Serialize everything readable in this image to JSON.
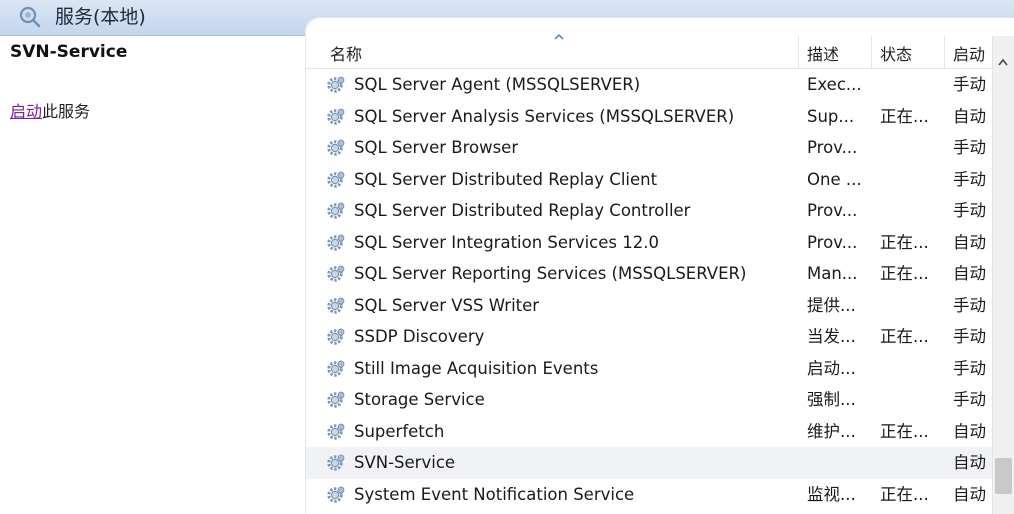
{
  "header": {
    "title": "服务(本地)"
  },
  "left_pane": {
    "service_name": "SVN-Service",
    "action_link": "启动",
    "action_rest": "此服务"
  },
  "columns": {
    "name": "名称",
    "desc": "描述",
    "status": "状态",
    "start": "启动"
  },
  "rows": [
    {
      "name": "SQL Server Agent (MSSQLSERVER)",
      "desc": "Exec...",
      "status": "",
      "start": "手动"
    },
    {
      "name": "SQL Server Analysis Services (MSSQLSERVER)",
      "desc": "Sup...",
      "status": "正在...",
      "start": "自动"
    },
    {
      "name": "SQL Server Browser",
      "desc": "Prov...",
      "status": "",
      "start": "手动"
    },
    {
      "name": "SQL Server Distributed Replay Client",
      "desc": "One ...",
      "status": "",
      "start": "手动"
    },
    {
      "name": "SQL Server Distributed Replay Controller",
      "desc": "Prov...",
      "status": "",
      "start": "手动"
    },
    {
      "name": "SQL Server Integration Services 12.0",
      "desc": "Prov...",
      "status": "正在...",
      "start": "自动"
    },
    {
      "name": "SQL Server Reporting Services (MSSQLSERVER)",
      "desc": "Man...",
      "status": "正在...",
      "start": "自动"
    },
    {
      "name": "SQL Server VSS Writer",
      "desc": "提供...",
      "status": "",
      "start": "手动"
    },
    {
      "name": "SSDP Discovery",
      "desc": "当发...",
      "status": "正在...",
      "start": "手动"
    },
    {
      "name": "Still Image Acquisition Events",
      "desc": "启动...",
      "status": "",
      "start": "手动"
    },
    {
      "name": "Storage Service",
      "desc": "强制...",
      "status": "",
      "start": "手动"
    },
    {
      "name": "Superfetch",
      "desc": "维护...",
      "status": "正在...",
      "start": "自动"
    },
    {
      "name": "SVN-Service",
      "desc": "",
      "status": "",
      "start": "自动",
      "selected": true
    },
    {
      "name": "System Event Notification Service",
      "desc": "监视...",
      "status": "正在...",
      "start": "自动"
    }
  ]
}
